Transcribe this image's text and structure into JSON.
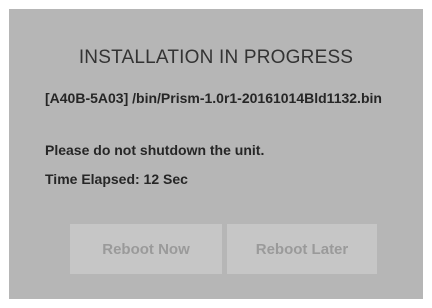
{
  "dialog": {
    "title": "INSTALLATION IN PROGRESS",
    "file_line": "[A40B-5A03] /bin/Prism-1.0r1-20161014Bld1132.bin",
    "warning": "Please do not shutdown the unit.",
    "elapsed": "Time Elapsed: 12 Sec"
  },
  "buttons": {
    "reboot_now": "Reboot Now",
    "reboot_later": "Reboot Later"
  },
  "colors": {
    "dialog_bg": "#b6b6b6",
    "button_bg": "#c6c6c6",
    "button_text_disabled": "#9a9a9a"
  }
}
